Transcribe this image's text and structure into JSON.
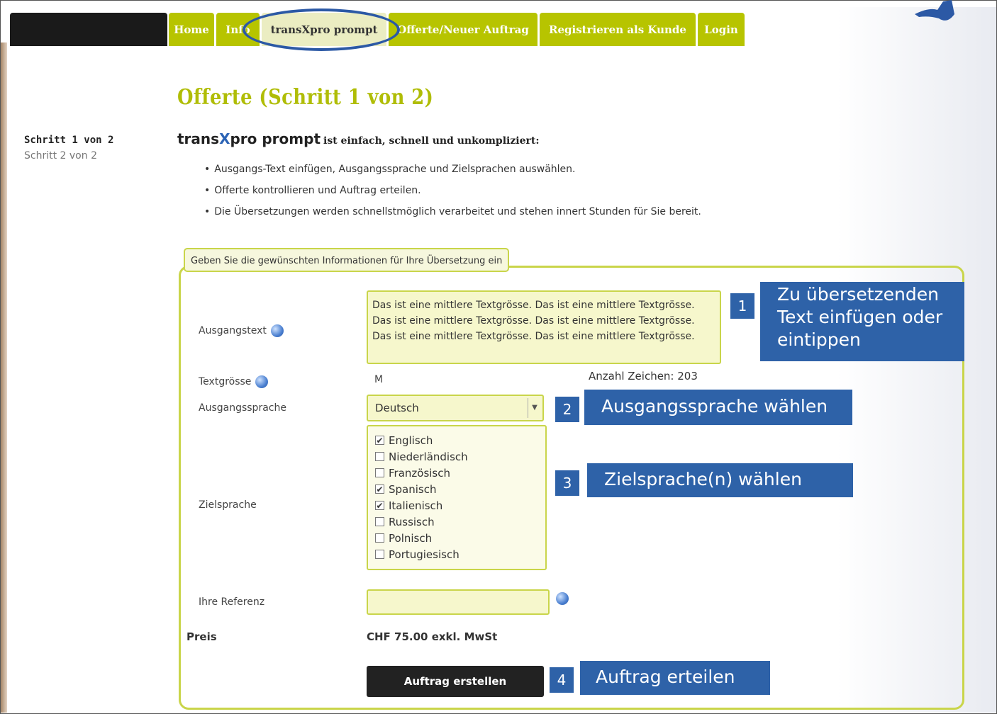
{
  "nav": {
    "tabs": [
      {
        "label": "Home"
      },
      {
        "label": "Info"
      },
      {
        "label": "transXpro prompt"
      },
      {
        "label": "Offerte/Neuer Auftrag"
      },
      {
        "label": "Registrieren als Kunde"
      },
      {
        "label": "Login"
      }
    ],
    "active_tab": "transXpro prompt"
  },
  "sidebar": {
    "steps": [
      {
        "label": "Schritt 1 von 2"
      },
      {
        "label": "Schritt 2 von 2"
      }
    ]
  },
  "page": {
    "title": "Offerte (Schritt 1 von 2)",
    "brand_prefix": "trans",
    "brand_x": "X",
    "brand_suffix": "pro prompt",
    "tagline": "ist einfach, schnell und unkompliziert:",
    "bullets": [
      "Ausgangs-Text einfügen, Ausgangssprache und Zielsprachen auswählen.",
      "Offerte kontrollieren und Auftrag erteilen.",
      "Die Übersetzungen werden schnellstmöglich verarbeitet und stehen innert Stunden für Sie bereit."
    ]
  },
  "form": {
    "legend": "Geben Sie die gewünschten Informationen für Ihre Übersetzung ein",
    "source_text_label": "Ausgangstext",
    "source_text": "Das ist eine mittlere Textgrösse. Das ist eine mittlere Textgrösse. Das ist eine mittlere Textgrösse. Das ist eine mittlere Textgrösse. Das ist eine mittlere Textgrösse. Das ist eine mittlere Textgrösse.",
    "text_size_label": "Textgrösse",
    "text_size_value": "M",
    "char_count": "Anzahl Zeichen: 203",
    "source_lang_label": "Ausgangssprache",
    "source_lang_value": "Deutsch",
    "target_lang_label": "Zielsprache",
    "target_langs": [
      {
        "name": "Englisch",
        "checked": true
      },
      {
        "name": "Niederländisch",
        "checked": false
      },
      {
        "name": "Französisch",
        "checked": false
      },
      {
        "name": "Spanisch",
        "checked": true
      },
      {
        "name": "Italienisch",
        "checked": true
      },
      {
        "name": "Russisch",
        "checked": false
      },
      {
        "name": "Polnisch",
        "checked": false
      },
      {
        "name": "Portugiesisch",
        "checked": false
      }
    ],
    "reference_label": "Ihre Referenz",
    "reference_value": "",
    "price_label": "Preis",
    "price_value": "CHF 75.00 exkl. MwSt",
    "submit_label": "Auftrag erstellen"
  },
  "annotations": [
    {
      "number": "1",
      "text": "Zu übersetzenden Text einfügen oder eintippen"
    },
    {
      "number": "2",
      "text": "Ausgangssprache wählen"
    },
    {
      "number": "3",
      "text": "Zielsprache(n) wählen"
    },
    {
      "number": "4",
      "text": "Auftrag erteilen"
    }
  ],
  "colors": {
    "accent": "#b7c400",
    "title": "#b0bd06",
    "annotation": "#2e62a8",
    "highlight_ring": "#2c59a5"
  }
}
